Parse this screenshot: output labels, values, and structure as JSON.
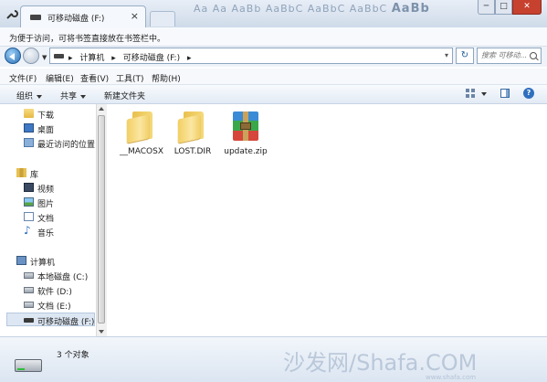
{
  "titlebar": {
    "tab_title": "可移动磁盘 (F:)",
    "tab_close": "×",
    "ribbon_text": "Aa    Aa    AaBb  AaBbC  AaBbC  AaBbC",
    "ribbon_bold": "AaBb",
    "window_buttons": [
      "─",
      "□",
      "✕"
    ]
  },
  "hint": {
    "text": "为便于访问，可将书签直接放在书签栏中。"
  },
  "address": {
    "crumbs": [
      "▸",
      "计算机",
      "▸",
      "可移动磁盘 (F:)",
      "▸"
    ],
    "refresh": "↻",
    "search_placeholder": "搜索 可移动..."
  },
  "menu": {
    "items": [
      "文件(F)",
      "编辑(E)",
      "查看(V)",
      "工具(T)",
      "帮助(H)"
    ]
  },
  "toolbar": {
    "organize": "组织",
    "share": "共享",
    "new_folder": "新建文件夹",
    "help": "?"
  },
  "nav": {
    "items": [
      {
        "label": "下载",
        "icon": "download-folder-icon"
      },
      {
        "label": "桌面",
        "icon": "desktop-icon"
      },
      {
        "label": "最近访问的位置",
        "icon": "recent-places-icon"
      },
      {
        "label": "库",
        "icon": "library-icon"
      },
      {
        "label": "视频",
        "icon": "video-icon"
      },
      {
        "label": "图片",
        "icon": "pictures-icon"
      },
      {
        "label": "文档",
        "icon": "documents-icon"
      },
      {
        "label": "音乐",
        "icon": "music-icon"
      },
      {
        "label": "计算机",
        "icon": "computer-icon"
      },
      {
        "label": "本地磁盘 (C:)",
        "icon": "local-disk-icon"
      },
      {
        "label": "软件 (D:)",
        "icon": "drive-icon"
      },
      {
        "label": "文档 (E:)",
        "icon": "drive-icon"
      },
      {
        "label": "可移动磁盘 (F:)",
        "icon": "usb-drive-icon"
      }
    ]
  },
  "files": [
    {
      "name": "__MACOSX",
      "icon": "folder-icon"
    },
    {
      "name": "LOST.DIR",
      "icon": "folder-icon"
    },
    {
      "name": "update.zip",
      "icon": "zip-archive-icon"
    }
  ],
  "details": {
    "count": "3 个对象"
  },
  "watermark": {
    "text": "沙发网/Shafa.COM",
    "sub": "www.shafa.com"
  }
}
